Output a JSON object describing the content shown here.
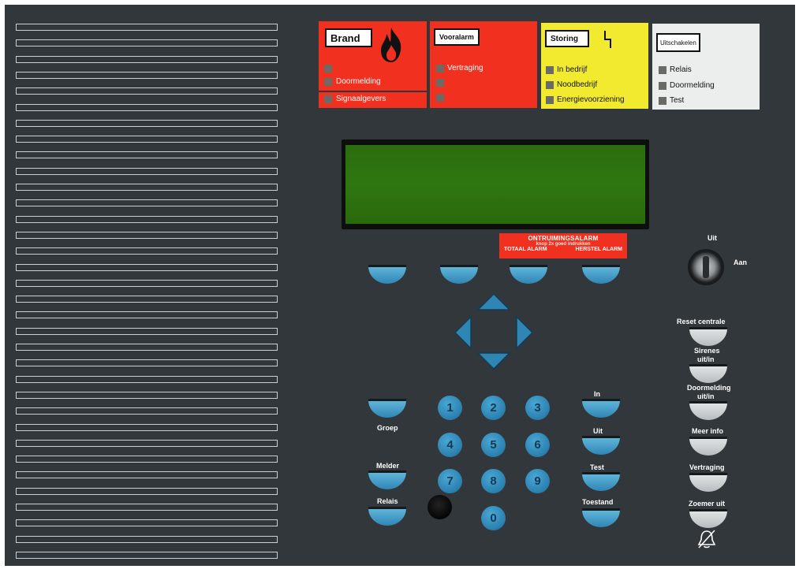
{
  "cards": {
    "brand": {
      "title": "Brand",
      "leds": [
        "",
        "Doormelding",
        "Signaalgevers"
      ]
    },
    "vooralarm": {
      "title": "Vooralarm",
      "leds": [
        "Vertraging",
        "",
        ""
      ]
    },
    "storing": {
      "title": "Storing",
      "leds": [
        "In bedrijf",
        "Noodbedrijf",
        "Energievoorziening"
      ]
    },
    "uitschakelen": {
      "title": "Uitschakelen",
      "leds": [
        "Relais",
        "Doormelding",
        "Test"
      ]
    }
  },
  "evacuation": {
    "title": "ONTRUIMINGSALARM",
    "hint": "knop 2x goed indrukken",
    "left": "TOTAAL ALARM",
    "right": "HERSTEL ALARM"
  },
  "keyswitch": {
    "off": "Uit",
    "on": "Aan"
  },
  "left_keys": {
    "groep": "Groep",
    "melder": "Melder",
    "relais": "Relais"
  },
  "right_keys": {
    "in": "In",
    "uit": "Uit",
    "test": "Test",
    "toestand": "Toestand"
  },
  "numpad": [
    "1",
    "2",
    "3",
    "4",
    "5",
    "6",
    "7",
    "8",
    "9",
    "0"
  ],
  "side_buttons": {
    "reset": "Reset centrale",
    "sirenes_1": "Sirenes",
    "sirenes_2": "uit/in",
    "doormelding_1": "Doormelding",
    "doormelding_2": "uit/in",
    "meer_info": "Meer info",
    "vertraging": "Vertraging",
    "zoemer": "Zoemer uit"
  },
  "colors": {
    "panel": "#32373b",
    "brand": "#f2301f",
    "storing": "#f1ea2e",
    "uitschakelen": "#eceeee",
    "key_blue": "#2f86b4",
    "lcd": "#2f7711"
  },
  "icons": [
    "flame-icon",
    "fault-bolt-icon",
    "bell-off-icon",
    "arrow-up-icon",
    "arrow-down-icon",
    "arrow-left-icon",
    "arrow-right-icon",
    "key-switch-icon"
  ]
}
